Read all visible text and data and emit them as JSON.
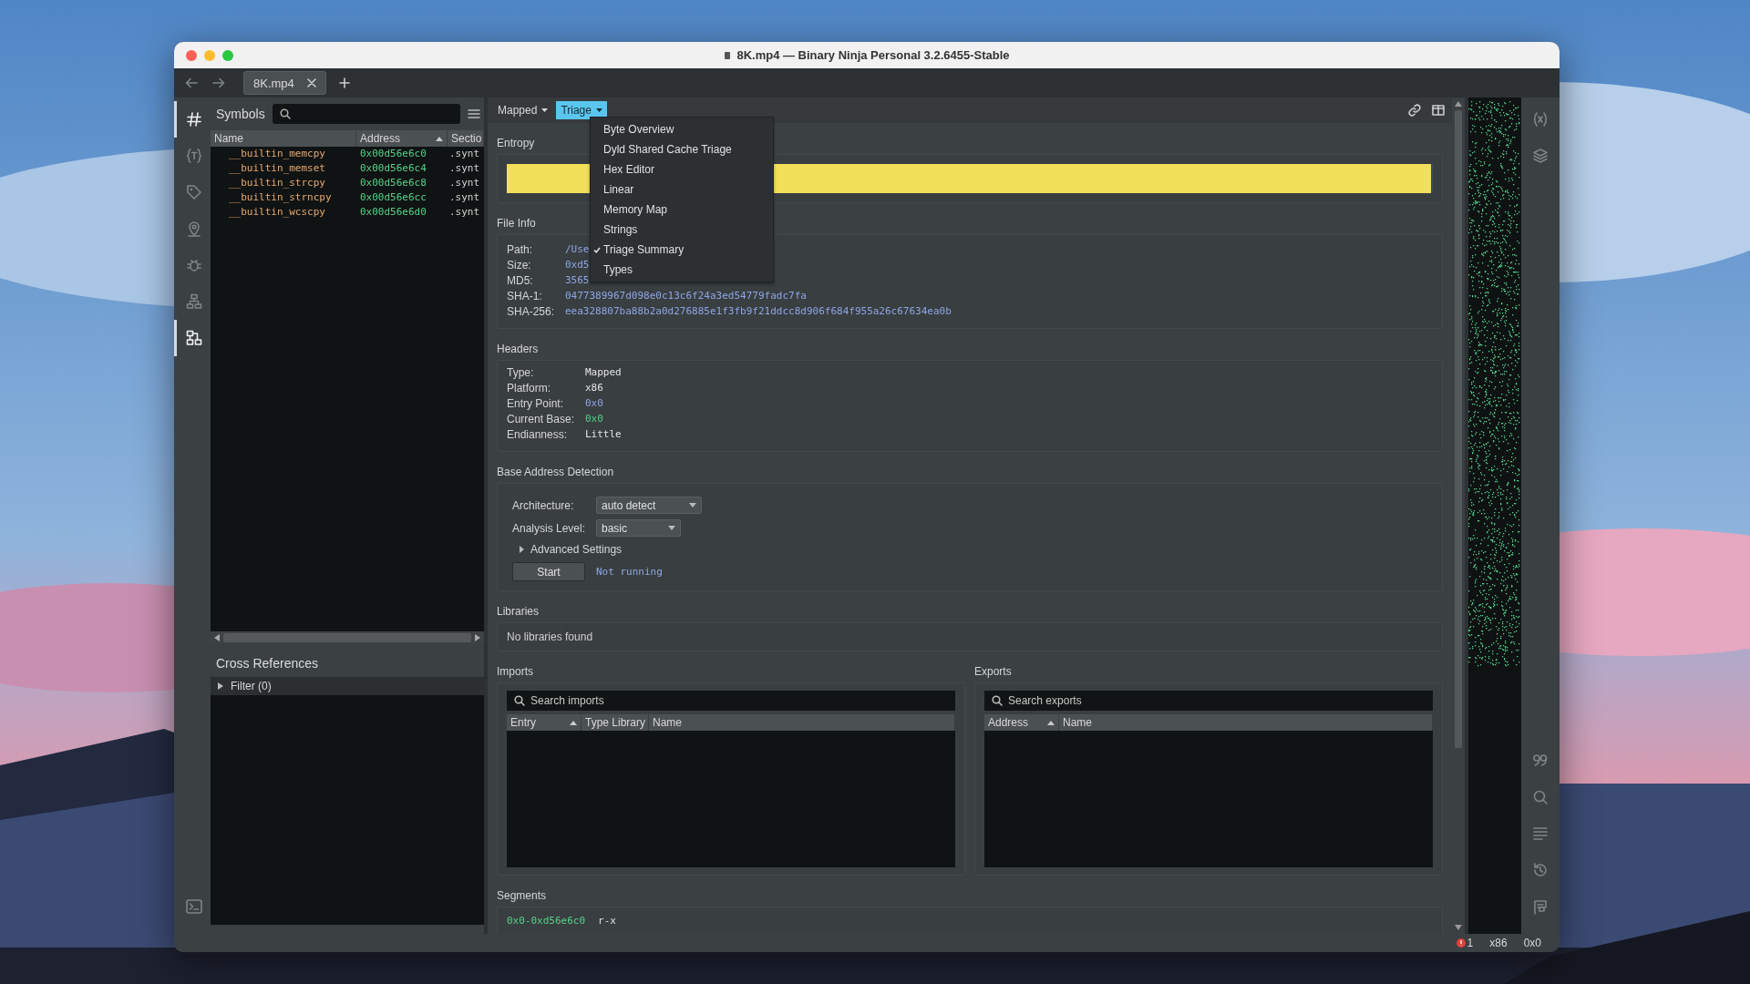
{
  "window": {
    "title": "8K.mp4 — Binary Ninja Personal 3.2.6455-Stable"
  },
  "tabs": [
    {
      "label": "8K.mp4",
      "selected": true
    }
  ],
  "left_sidebar": {
    "items": [
      {
        "selected": true
      },
      {
        "selected": false
      },
      {
        "selected": false
      },
      {
        "selected": false
      },
      {
        "selected": false
      },
      {
        "selected": false
      },
      {
        "selected": true
      }
    ]
  },
  "symbols": {
    "title": "Symbols",
    "columns": [
      {
        "label": "Name",
        "sorted": false
      },
      {
        "label": "Address",
        "sorted": true
      },
      {
        "label": "Sectio",
        "sorted": false
      }
    ],
    "rows": [
      {
        "name": "__builtin_memcpy",
        "address": "0x00d56e6c0",
        "section": ".synt"
      },
      {
        "name": "__builtin_memset",
        "address": "0x00d56e6c4",
        "section": ".synt"
      },
      {
        "name": "__builtin_strcpy",
        "address": "0x00d56e6c8",
        "section": ".synt"
      },
      {
        "name": "__builtin_strncpy",
        "address": "0x00d56e6cc",
        "section": ".synt"
      },
      {
        "name": "__builtin_wcscpy",
        "address": "0x00d56e6d0",
        "section": ".synt"
      }
    ]
  },
  "cross_references": {
    "title": "Cross References",
    "filter": {
      "label": "Filter (0)",
      "expanded": false
    }
  },
  "view_bar": {
    "views": [
      {
        "label": "Mapped",
        "selected": false
      },
      {
        "label": "Triage",
        "selected": true
      }
    ]
  },
  "view_menu": {
    "items": [
      {
        "label": "Byte Overview",
        "checked": false
      },
      {
        "label": "Dyld Shared Cache Triage",
        "checked": false
      },
      {
        "label": "Hex Editor",
        "checked": false
      },
      {
        "label": "Linear",
        "checked": false
      },
      {
        "label": "Memory Map",
        "checked": false
      },
      {
        "label": "Strings",
        "checked": false
      },
      {
        "label": "Triage Summary",
        "checked": true
      },
      {
        "label": "Types",
        "checked": false
      }
    ]
  },
  "entropy": {
    "title": "Entropy",
    "level": 1
  },
  "file_info": {
    "title": "File Info",
    "fields": [
      {
        "label": "Path:",
        "value": "/Use"
      },
      {
        "label": "Size:",
        "value": "0xd5"
      },
      {
        "label": "MD5:",
        "value": "3565"
      },
      {
        "label": "SHA-1:",
        "value": "0477389967d098e0c13c6f24a3ed54779fadc7fa"
      },
      {
        "label": "SHA-256:",
        "value": "eea328807ba88b2a0d276885e1f3fb9f21ddcc8d906f684f955a26c67634ea0b"
      }
    ]
  },
  "headers": {
    "title": "Headers",
    "fields": [
      {
        "label": "Type:",
        "value": "Mapped",
        "kind": "text"
      },
      {
        "label": "Platform:",
        "value": "x86",
        "kind": "text"
      },
      {
        "label": "Entry Point:",
        "value": "0x0",
        "kind": "link"
      },
      {
        "label": "Current Base:",
        "value": "0x0",
        "kind": "address"
      },
      {
        "label": "Endianness:",
        "value": "Little",
        "kind": "text"
      }
    ]
  },
  "base_address_detection": {
    "title": "Base Address Detection",
    "architecture": {
      "label": "Architecture:",
      "value": "auto detect"
    },
    "analysis_level": {
      "label": "Analysis Level:",
      "value": "basic"
    },
    "advanced_settings": {
      "label": "Advanced Settings",
      "expanded": false
    },
    "start_button": "Start",
    "status": "Not running"
  },
  "libraries": {
    "title": "Libraries",
    "message": "No libraries found"
  },
  "imports": {
    "title": "Imports",
    "search": {
      "placeholder": "Search imports"
    },
    "columns": [
      {
        "label": "Entry",
        "sorted": true
      },
      {
        "label": "Type Library",
        "sorted": false
      },
      {
        "label": "Name",
        "sorted": false
      }
    ]
  },
  "exports": {
    "title": "Exports",
    "search": {
      "placeholder": "Search exports"
    },
    "columns": [
      {
        "label": "Address",
        "sorted": true
      },
      {
        "label": "Name",
        "sorted": false
      }
    ]
  },
  "segments": {
    "title": "Segments",
    "rows": [
      {
        "range": "0x0-0xd56e6c0",
        "permissions": "r-x"
      }
    ]
  },
  "status_bar": {
    "errors": "1",
    "architecture": "x86",
    "address": "0x0"
  }
}
